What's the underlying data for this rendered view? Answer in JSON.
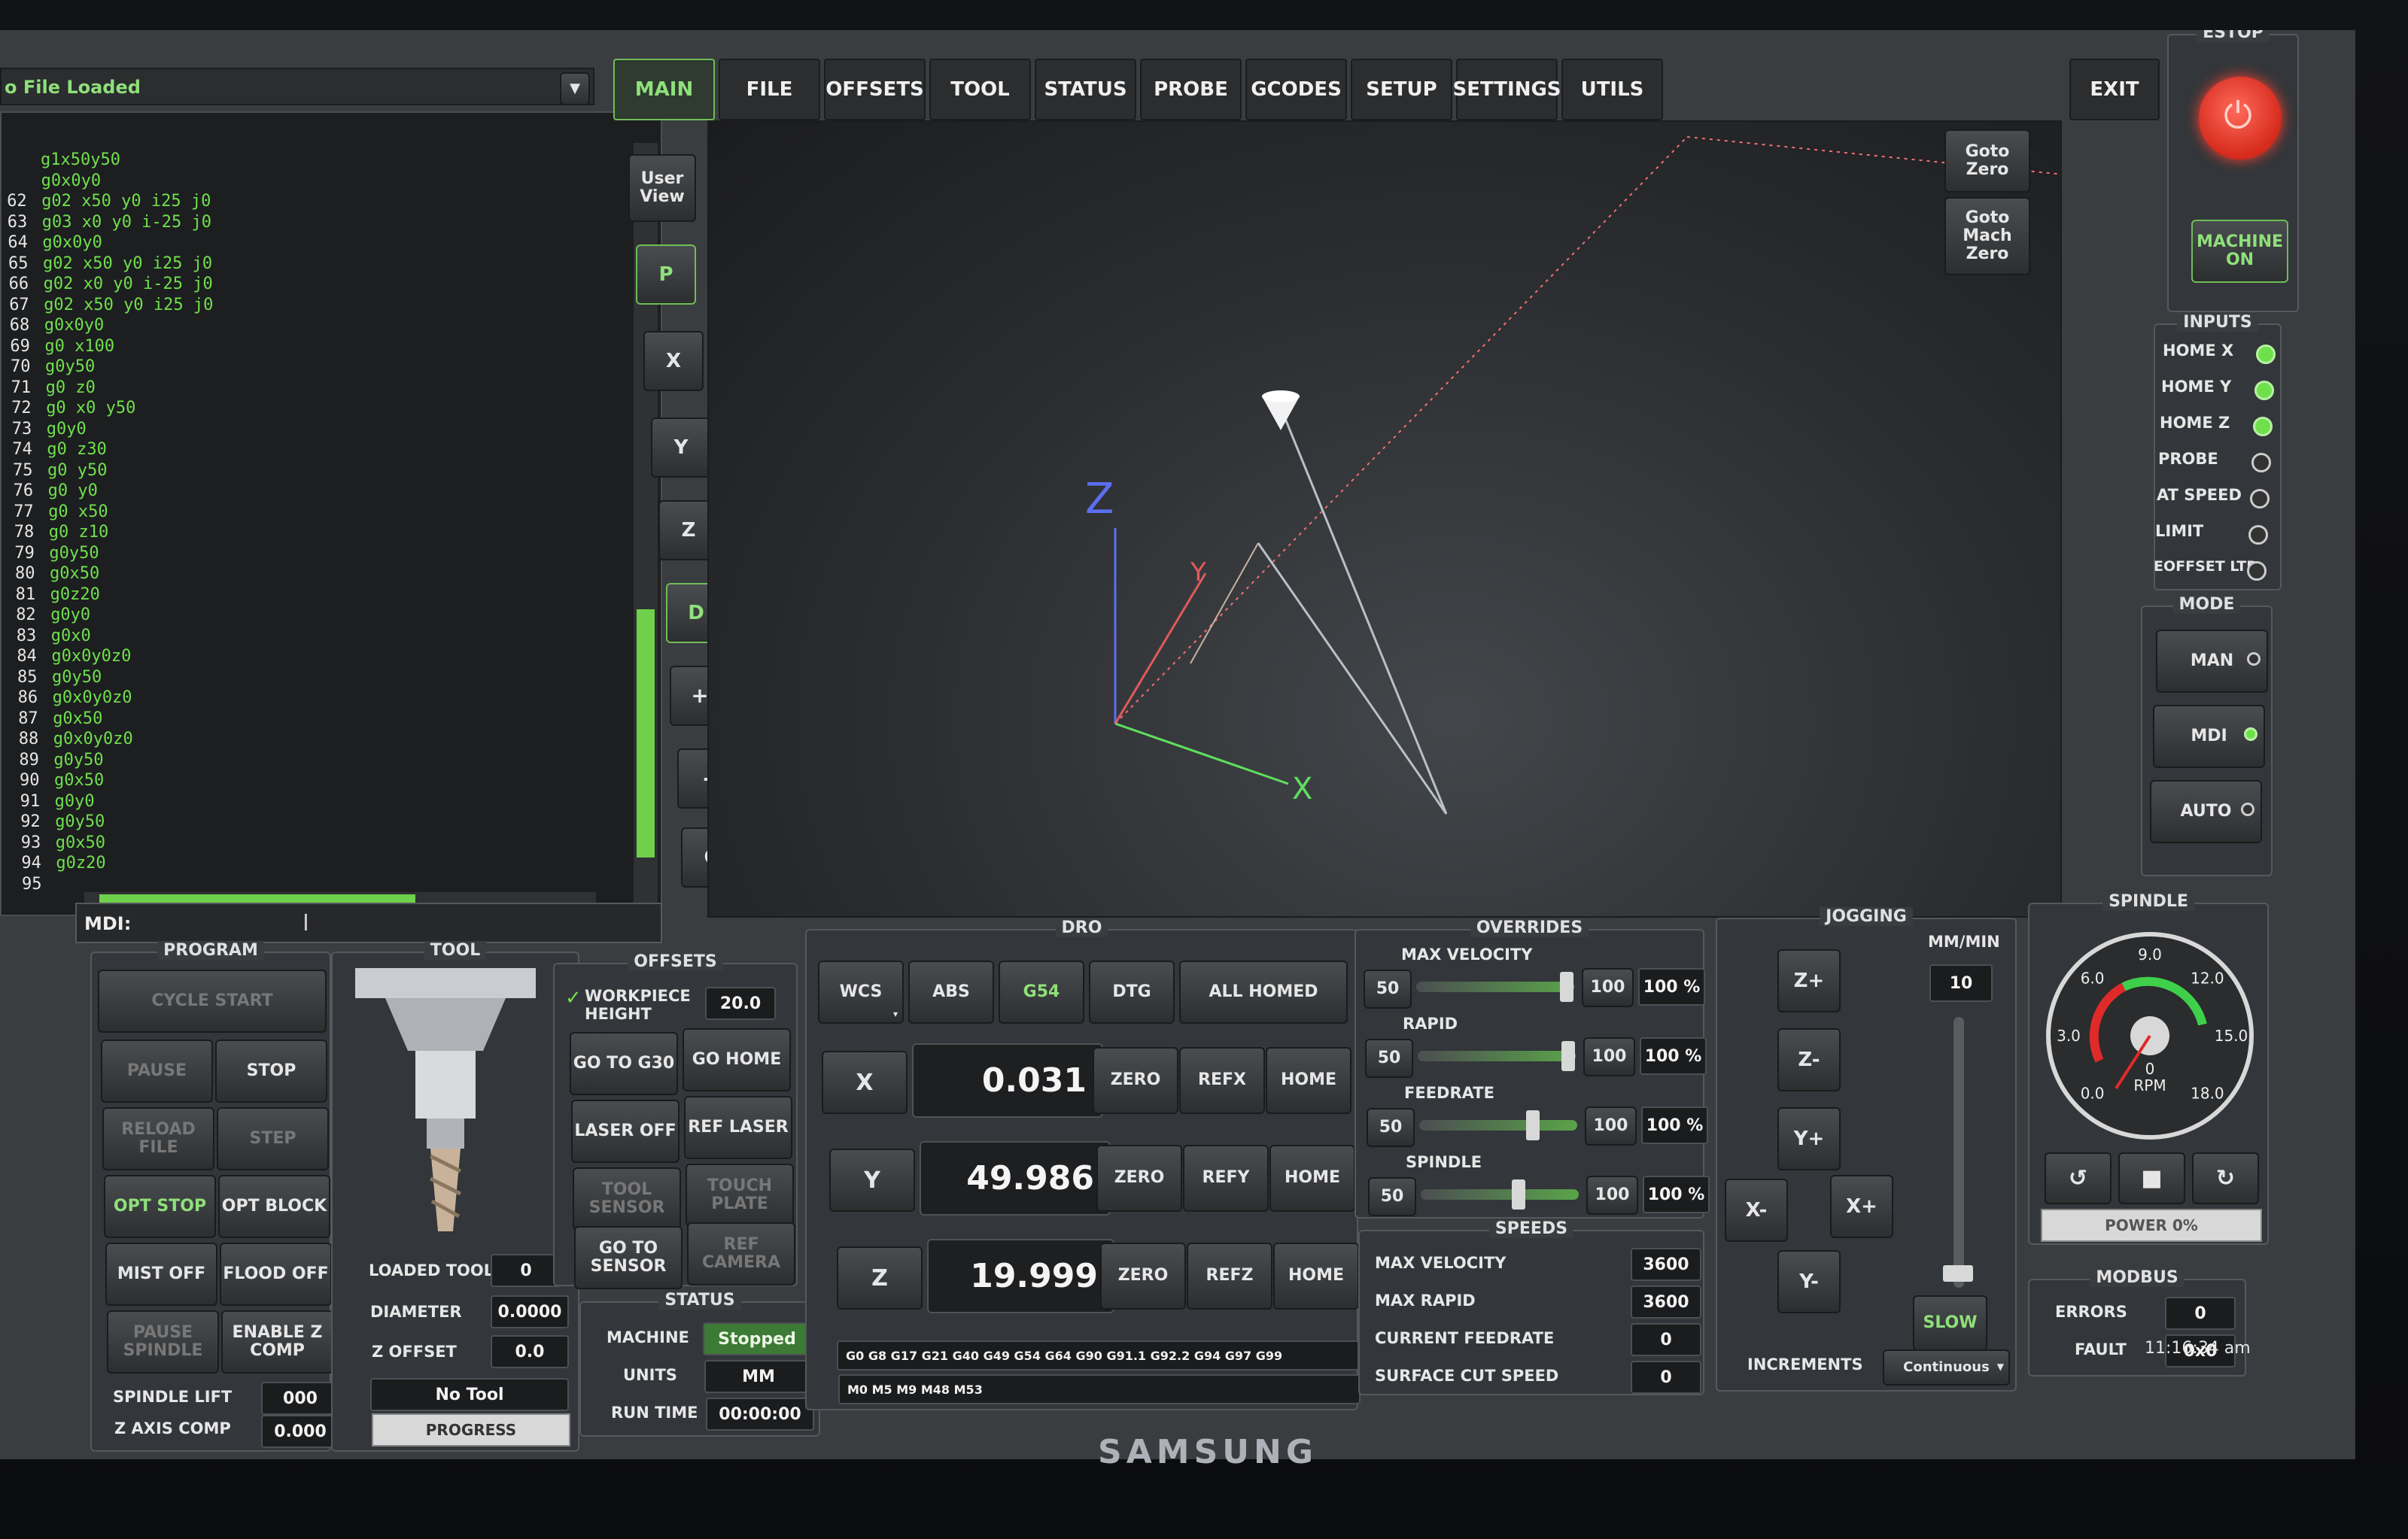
{
  "file_status": "o File Loaded",
  "tabs": [
    "MAIN",
    "FILE",
    "OFFSETS",
    "TOOL",
    "STATUS",
    "PROBE",
    "GCODES",
    "SETUP",
    "SETTINGS",
    "UTILS"
  ],
  "exit_label": "EXIT",
  "gcode_lines": [
    {
      "n": "",
      "code": "g1x50y50"
    },
    {
      "n": "",
      "code": "g0x0y0"
    },
    {
      "n": "62",
      "code": "g02 x50 y0 i25 j0"
    },
    {
      "n": "63",
      "code": "g03 x0 y0 i-25 j0"
    },
    {
      "n": "64",
      "code": "g0x0y0"
    },
    {
      "n": "65",
      "code": "g02 x50 y0 i25 j0"
    },
    {
      "n": "66",
      "code": "g02 x0 y0 i-25 j0"
    },
    {
      "n": "67",
      "code": "g02 x50 y0 i25 j0"
    },
    {
      "n": "68",
      "code": "g0x0y0"
    },
    {
      "n": "69",
      "code": "g0 x100"
    },
    {
      "n": "70",
      "code": "g0y50"
    },
    {
      "n": "71",
      "code": "g0 z0"
    },
    {
      "n": "72",
      "code": "g0 x0 y50"
    },
    {
      "n": "73",
      "code": "g0y0"
    },
    {
      "n": "74",
      "code": "g0 z30"
    },
    {
      "n": "75",
      "code": "g0 y50"
    },
    {
      "n": "76",
      "code": "g0 y0"
    },
    {
      "n": "77",
      "code": "g0 x50"
    },
    {
      "n": "78",
      "code": "g0 z10"
    },
    {
      "n": "79",
      "code": "g0y50"
    },
    {
      "n": "80",
      "code": "g0x50"
    },
    {
      "n": "81",
      "code": "g0z20"
    },
    {
      "n": "82",
      "code": "g0y0"
    },
    {
      "n": "83",
      "code": "g0x0"
    },
    {
      "n": "84",
      "code": "g0x0y0z0"
    },
    {
      "n": "85",
      "code": "g0y50"
    },
    {
      "n": "86",
      "code": "g0x0y0z0"
    },
    {
      "n": "87",
      "code": "g0x50"
    },
    {
      "n": "88",
      "code": "g0x0y0z0"
    },
    {
      "n": "89",
      "code": "g0y50"
    },
    {
      "n": "90",
      "code": "g0x50"
    },
    {
      "n": "91",
      "code": "g0y0"
    },
    {
      "n": "92",
      "code": "g0y50"
    },
    {
      "n": "93",
      "code": "g0x50"
    },
    {
      "n": "94",
      "code": "g0z20"
    },
    {
      "n": "95",
      "code": ""
    }
  ],
  "mdi_label": "MDI:",
  "view_buttons": [
    "User View",
    "P",
    "X",
    "Y",
    "Z",
    "D",
    "+",
    "-",
    "C"
  ],
  "goto_zero": "Goto Zero",
  "goto_mach_zero": "Goto Mach Zero",
  "axis_labels": {
    "z": "Z",
    "y": "Y",
    "x": "X"
  },
  "estop": {
    "title": "ESTOP",
    "machine_on": "MACHINE ON"
  },
  "inputs": {
    "title": "INPUTS",
    "items": [
      {
        "label": "HOME X",
        "on": true
      },
      {
        "label": "HOME Y",
        "on": true
      },
      {
        "label": "HOME Z",
        "on": true
      },
      {
        "label": "PROBE",
        "on": false
      },
      {
        "label": "AT SPEED",
        "on": false
      },
      {
        "label": "LIMIT",
        "on": false
      },
      {
        "label": "EOFFSET LTD",
        "on": false
      }
    ]
  },
  "mode": {
    "title": "MODE",
    "items": [
      {
        "label": "MAN",
        "on": false
      },
      {
        "label": "MDI",
        "on": true
      },
      {
        "label": "AUTO",
        "on": false
      }
    ]
  },
  "program": {
    "title": "PROGRAM",
    "cycle_start": "CYCLE START",
    "pause": "PAUSE",
    "stop": "STOP",
    "reload": "RELOAD FILE",
    "step": "STEP",
    "opt_stop": "OPT STOP",
    "opt_block": "OPT BLOCK",
    "mist": "MIST OFF",
    "flood": "FLOOD OFF",
    "pause_spindle": "PAUSE SPINDLE",
    "enable_zcomp": "ENABLE Z COMP",
    "spindle_lift_label": "SPINDLE LIFT",
    "spindle_lift": "000",
    "zaxis_comp_label": "Z AXIS COMP",
    "zaxis_comp": "0.000"
  },
  "tool": {
    "title": "TOOL",
    "loaded_label": "LOADED TOOL",
    "loaded": "0",
    "diameter_label": "DIAMETER",
    "diameter": "0.0000",
    "zoffset_label": "Z OFFSET",
    "zoffset": "0.0",
    "no_tool": "No Tool",
    "progress": "PROGRESS"
  },
  "offsets": {
    "title": "OFFSETS",
    "wp_label": "WORKPIECE HEIGHT",
    "wp_value": "20.0",
    "goto_g30": "GO TO G30",
    "go_home": "GO HOME",
    "laser_off": "LASER OFF",
    "ref_laser": "REF LASER",
    "tool_sensor": "TOOL SENSOR",
    "touch_plate": "TOUCH PLATE",
    "goto_sensor": "GO TO SENSOR",
    "ref_camera": "REF CAMERA"
  },
  "status": {
    "title": "STATUS",
    "machine_label": "MACHINE",
    "machine": "Stopped",
    "units_label": "UNITS",
    "units": "MM",
    "runtime_label": "RUN TIME",
    "runtime": "00:00:00"
  },
  "dro": {
    "title": "DRO",
    "wcs": "WCS",
    "abs": "ABS",
    "g54": "G54",
    "dtg": "DTG",
    "all_homed": "ALL HOMED",
    "axes": [
      {
        "axis": "X",
        "value": "0.031",
        "zero": "ZERO",
        "ref": "REFX",
        "home": "HOME"
      },
      {
        "axis": "Y",
        "value": "49.986",
        "zero": "ZERO",
        "ref": "REFY",
        "home": "HOME"
      },
      {
        "axis": "Z",
        "value": "19.999",
        "zero": "ZERO",
        "ref": "REFZ",
        "home": "HOME"
      }
    ],
    "gcodes": "G0 G8 G17 G21 G40 G49 G54 G64 G90 G91.1 G92.2 G94 G97 G99",
    "mcodes": "M0 M5 M9 M48 M53"
  },
  "overrides": {
    "title": "OVERRIDES",
    "rows": [
      {
        "label": "MAX VELOCITY",
        "low": "50",
        "high": "100",
        "pct": "100 %",
        "level": 0.95
      },
      {
        "label": "RAPID",
        "low": "50",
        "high": "100",
        "pct": "100 %",
        "level": 0.95
      },
      {
        "label": "FEEDRATE",
        "low": "50",
        "high": "100",
        "pct": "100 %",
        "level": 0.72
      },
      {
        "label": "SPINDLE",
        "low": "50",
        "high": "100",
        "pct": "100 %",
        "level": 0.62
      }
    ]
  },
  "speeds": {
    "title": "SPEEDS",
    "rows": [
      {
        "label": "MAX VELOCITY",
        "value": "3600"
      },
      {
        "label": "MAX RAPID",
        "value": "3600"
      },
      {
        "label": "CURRENT FEEDRATE",
        "value": "0"
      },
      {
        "label": "SURFACE CUT SPEED",
        "value": "0"
      }
    ]
  },
  "jogging": {
    "title": "JOGGING",
    "units": "MM/MIN",
    "rate": "10",
    "z_plus": "Z+",
    "z_minus": "Z-",
    "y_plus": "Y+",
    "y_minus": "Y-",
    "x_minus": "X-",
    "x_plus": "X+",
    "slow": "SLOW",
    "increments_label": "INCREMENTS",
    "increments": "Continuous"
  },
  "spindle": {
    "title": "SPINDLE",
    "ticks": [
      "0.0",
      "3.0",
      "6.0",
      "9.0",
      "12.0",
      "15.0",
      "18.0"
    ],
    "rpm_value": "0",
    "rpm_label": "RPM",
    "power": "POWER 0%"
  },
  "modbus": {
    "title": "MODBUS",
    "errors_label": "ERRORS",
    "errors": "0",
    "fault_label": "FAULT",
    "fault": "0x0"
  },
  "clock": "11:16:34 am",
  "monitor_brand": "SAMSUNG"
}
